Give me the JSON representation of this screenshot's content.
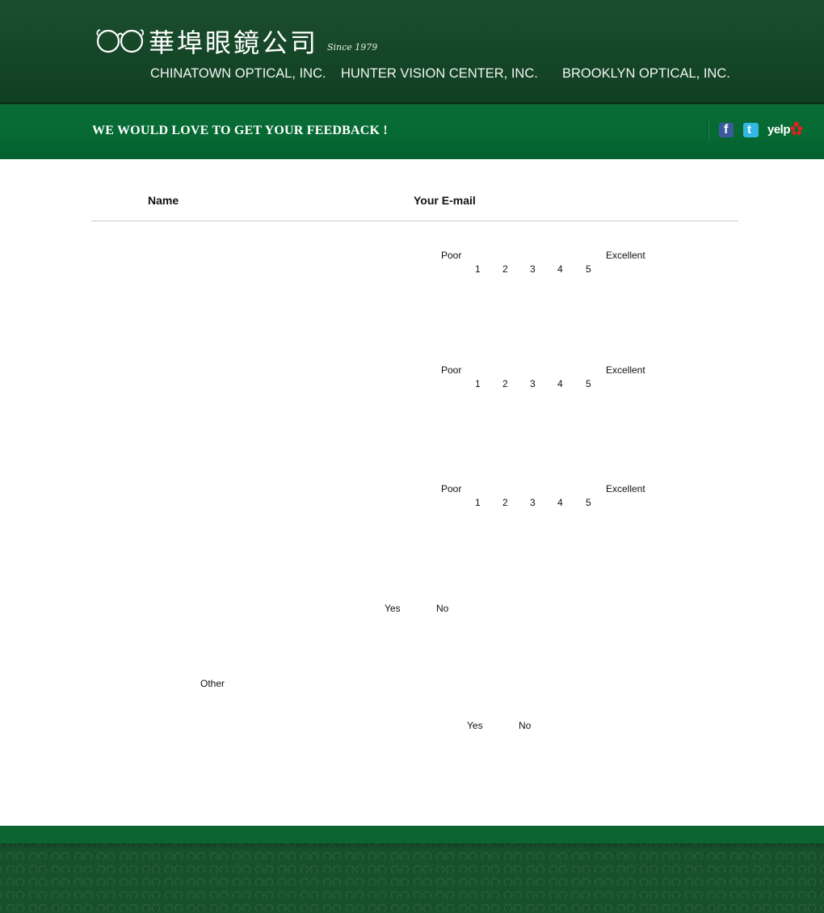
{
  "header": {
    "logo_chinese": "華埠眼鏡公司",
    "logo_since": "Since 1979",
    "companies": [
      "CHINATOWN OPTICAL, INC.",
      "HUNTER VISION CENTER, INC.",
      "BROOKLYN OPTICAL, INC."
    ]
  },
  "banner": {
    "title": "WE WOULD LOVE TO GET YOUR FEEDBACK !",
    "social_icons": [
      "facebook-icon",
      "twitter-icon",
      "yelp-icon"
    ],
    "social": {
      "facebook": "f",
      "twitter": "t",
      "yelp": "yelp"
    }
  },
  "form": {
    "name_label": "Name",
    "email_label": "Your E-mail",
    "ratings": [
      {
        "low_label": "Poor",
        "high_label": "Excellent",
        "scale": [
          "1",
          "2",
          "3",
          "4",
          "5"
        ]
      },
      {
        "low_label": "Poor",
        "high_label": "Excellent",
        "scale": [
          "1",
          "2",
          "3",
          "4",
          "5"
        ]
      },
      {
        "low_label": "Poor",
        "high_label": "Excellent",
        "scale": [
          "1",
          "2",
          "3",
          "4",
          "5"
        ]
      }
    ],
    "yes_no_1": {
      "yes": "Yes",
      "no": "No"
    },
    "other_label": "Other",
    "yes_no_2": {
      "yes": "Yes",
      "no": "No"
    }
  },
  "colors": {
    "header_green": "#154527",
    "banner_green": "#066a33",
    "footer_green": "#17502c"
  }
}
